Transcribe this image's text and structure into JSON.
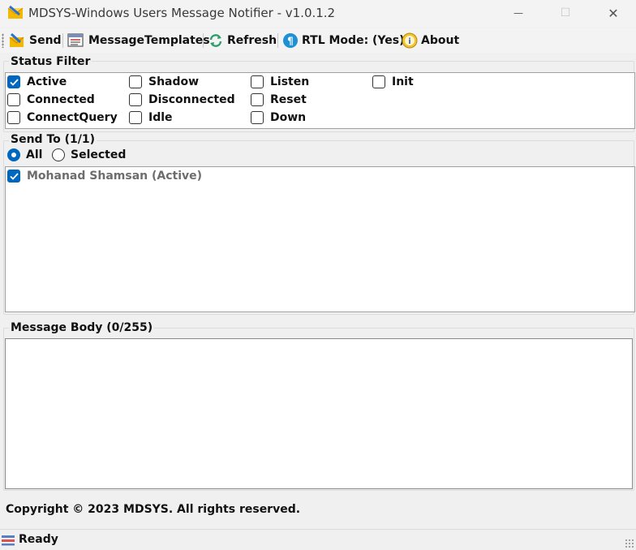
{
  "window": {
    "title": "MDSYS-Windows Users Message Notifier - v1.0.1.2",
    "minimize_glyph": "—",
    "maximize_glyph": "☐",
    "close_glyph": "✕"
  },
  "toolbar": {
    "send_label": "Send",
    "templates_label": "MessageTemplates",
    "refresh_label": "Refresh",
    "rtl_label": "RTL Mode: (Yes)",
    "about_label": "About"
  },
  "status_filter": {
    "title": "Status Filter",
    "options": [
      {
        "label": "Active",
        "checked": true
      },
      {
        "label": "Shadow",
        "checked": false
      },
      {
        "label": "Listen",
        "checked": false
      },
      {
        "label": "Init",
        "checked": false
      },
      {
        "label": "Connected",
        "checked": false
      },
      {
        "label": "Disconnected",
        "checked": false
      },
      {
        "label": "Reset",
        "checked": false
      },
      {
        "label": "ConnectQuery",
        "checked": false
      },
      {
        "label": "Idle",
        "checked": false
      },
      {
        "label": "Down",
        "checked": false
      }
    ]
  },
  "send_to": {
    "title": "Send To (1/1)",
    "radio_all": "All",
    "radio_selected": "Selected",
    "selected_mode": "All",
    "users": [
      {
        "label": "Mohanad Shamsan (Active)",
        "checked": true
      }
    ]
  },
  "message": {
    "title": "Message Body (0/255)",
    "value": ""
  },
  "footer": {
    "copyright": "Copyright © 2023 MDSYS. All rights reserved."
  },
  "statusbar": {
    "text": "Ready"
  },
  "colors": {
    "accent": "#0067c0",
    "background": "#f0f0f0"
  }
}
